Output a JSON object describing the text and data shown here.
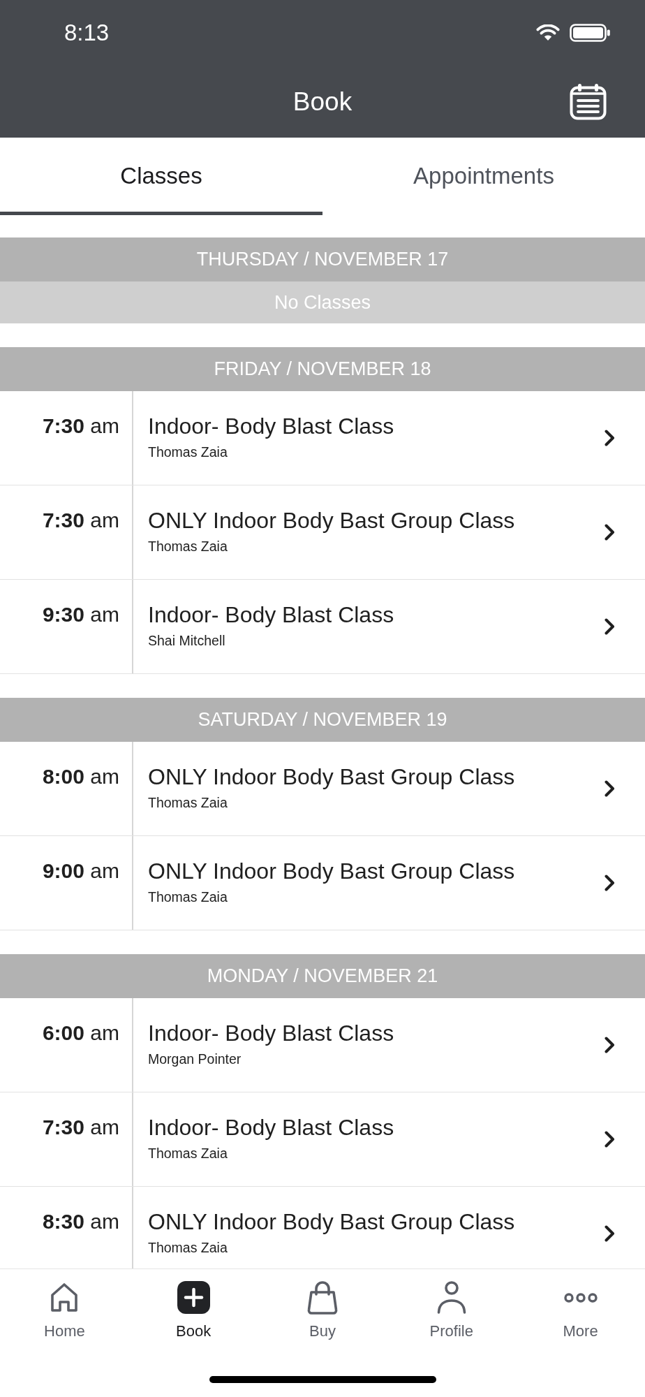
{
  "status_bar": {
    "time": "8:13"
  },
  "header": {
    "title": "Book"
  },
  "tabs": [
    {
      "label": "Classes",
      "selected": true
    },
    {
      "label": "Appointments",
      "selected": false
    }
  ],
  "schedule": [
    {
      "date": "THURSDAY / NOVEMBER 17",
      "empty_message": "No Classes"
    },
    {
      "date": "FRIDAY / NOVEMBER 18",
      "classes": [
        {
          "time": "**7:30** am",
          "title": "Indoor- Body Blast Class",
          "instructor": "Thomas Zaia"
        },
        {
          "time": "**7:30** am",
          "title": "ONLY Indoor Body Bast Group Class",
          "instructor": "Thomas Zaia"
        },
        {
          "time": "**9:30** am",
          "title": "Indoor- Body Blast Class",
          "instructor": "Shai Mitchell"
        }
      ]
    },
    {
      "date": "SATURDAY / NOVEMBER 19",
      "classes": [
        {
          "time": "**8:00** am",
          "title": "ONLY Indoor Body Bast Group Class",
          "instructor": "Thomas Zaia"
        },
        {
          "time": "**9:00** am",
          "title": "ONLY Indoor Body Bast Group Class",
          "instructor": "Thomas Zaia"
        }
      ]
    },
    {
      "date": "MONDAY / NOVEMBER 21",
      "classes": [
        {
          "time": "**6:00** am",
          "title": "Indoor- Body Blast Class",
          "instructor": "Morgan Pointer"
        },
        {
          "time": "**7:30** am",
          "title": "Indoor- Body Blast Class",
          "instructor": "Thomas Zaia"
        },
        {
          "time": "**8:30** am",
          "title": "ONLY Indoor Body Bast Group Class",
          "instructor": "Thomas Zaia"
        }
      ]
    }
  ],
  "tab_bar": [
    {
      "label": "Home",
      "selected": false
    },
    {
      "label": "Book",
      "selected": true
    },
    {
      "label": "Buy",
      "selected": false
    },
    {
      "label": "Profile",
      "selected": false
    },
    {
      "label": "More",
      "selected": false
    }
  ]
}
